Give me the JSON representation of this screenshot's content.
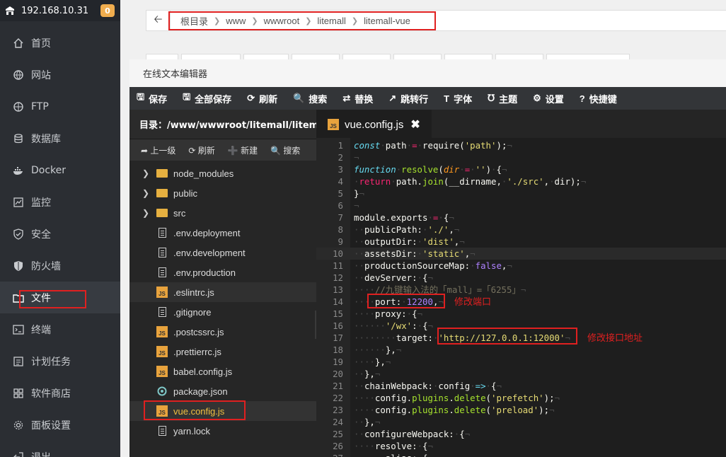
{
  "sidebar": {
    "server_ip": "192.168.10.31",
    "badge": "0",
    "items": [
      {
        "label": "首页",
        "icon": "home-icon"
      },
      {
        "label": "网站",
        "icon": "globe-icon"
      },
      {
        "label": "FTP",
        "icon": "ftp-icon"
      },
      {
        "label": "数据库",
        "icon": "database-icon"
      },
      {
        "label": "Docker",
        "icon": "docker-icon"
      },
      {
        "label": "监控",
        "icon": "monitor-icon"
      },
      {
        "label": "安全",
        "icon": "shield-icon"
      },
      {
        "label": "防火墙",
        "icon": "firewall-icon"
      },
      {
        "label": "文件",
        "icon": "folder-icon"
      },
      {
        "label": "终端",
        "icon": "terminal-icon"
      },
      {
        "label": "计划任务",
        "icon": "task-icon"
      },
      {
        "label": "软件商店",
        "icon": "store-icon"
      },
      {
        "label": "面板设置",
        "icon": "gear-icon"
      },
      {
        "label": "退出",
        "icon": "logout-icon"
      }
    ]
  },
  "breadcrumb": [
    "根目录",
    "www",
    "wwwroot",
    "litemall",
    "litemall-vue"
  ],
  "editor": {
    "title": "在线文本编辑器",
    "toolbar": [
      "保存",
      "全部保存",
      "刷新",
      "搜索",
      "替换",
      "跳转行",
      "字体",
      "主题",
      "设置",
      "快捷键"
    ],
    "directory": "目录：/www/wwwroot/litemall/litemall...",
    "file_actions": [
      "上一级",
      "刷新",
      "新建",
      "搜索"
    ],
    "files": [
      {
        "name": "node_modules",
        "type": "folder"
      },
      {
        "name": "public",
        "type": "folder"
      },
      {
        "name": "src",
        "type": "folder"
      },
      {
        "name": ".env.deployment",
        "type": "doc"
      },
      {
        "name": ".env.development",
        "type": "doc"
      },
      {
        "name": ".env.production",
        "type": "doc"
      },
      {
        "name": ".eslintrc.js",
        "type": "js"
      },
      {
        "name": ".gitignore",
        "type": "doc"
      },
      {
        "name": ".postcssrc.js",
        "type": "js"
      },
      {
        "name": ".prettierrc.js",
        "type": "js"
      },
      {
        "name": "babel.config.js",
        "type": "js"
      },
      {
        "name": "package.json",
        "type": "json"
      },
      {
        "name": "vue.config.js",
        "type": "js"
      },
      {
        "name": "yarn.lock",
        "type": "doc"
      }
    ],
    "tab": "vue.config.js",
    "annotations": {
      "port": "修改端口",
      "target": "修改接口地址"
    }
  },
  "colors": {
    "sidebar": "#2b2e33",
    "highlight": "#e02020",
    "badge": "#f0ad4e"
  }
}
